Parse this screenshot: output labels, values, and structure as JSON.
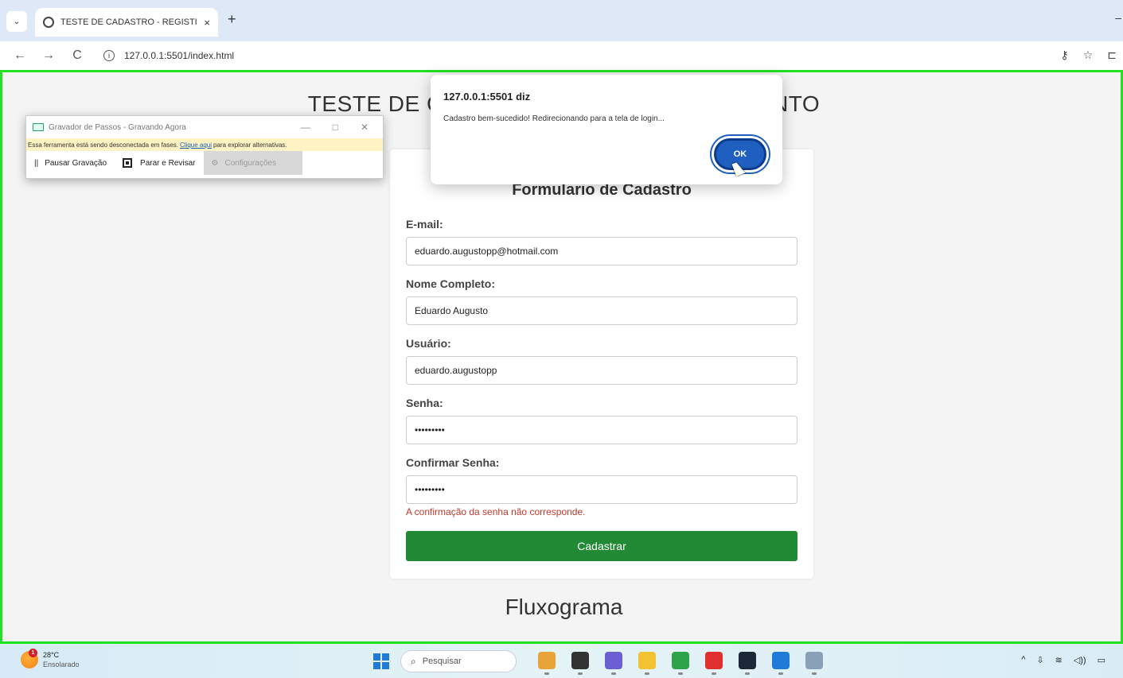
{
  "browser": {
    "tab_title": "TESTE DE CADASTRO - REGISTI",
    "tab_close": "×",
    "tab_list": "⌄",
    "new_tab": "+",
    "window_minimize": "–",
    "nav_back": "←",
    "nav_forward": "→",
    "nav_reload": "C",
    "url_icon": "i",
    "url": "127.0.0.1:5501/index.html",
    "toolbar_icons": [
      "key-icon",
      "star-icon",
      "extensions-icon"
    ],
    "toolbar_glyphs": [
      "⚷",
      "☆",
      "⊏"
    ]
  },
  "page": {
    "title": "TESTE DE CADASTRO - REGISTRO DE PONTO",
    "form": {
      "title": "Formulario de Cadastro",
      "email_label": "E-mail:",
      "email_value": "eduardo.augustopp@hotmail.com",
      "name_label": "Nome Completo:",
      "name_value": "Eduardo Augusto",
      "user_label": "Usuário:",
      "user_value": "eduardo.augustopp",
      "password_label": "Senha:",
      "password_value": "•••••••••",
      "confirm_label": "Confirmar Senha:",
      "confirm_value": "•••••••••",
      "error": "A confirmação da senha não corresponde.",
      "submit": "Cadastrar"
    },
    "section_title": "Fluxograma"
  },
  "alert": {
    "origin": "127.0.0.1:5501 diz",
    "message": "Cadastro bem-sucedido! Redirecionando para a tela de login...",
    "ok": "OK"
  },
  "recorder": {
    "title": "Gravador de Passos - Gravando Agora",
    "win_min": "—",
    "win_max": "□",
    "win_close": "✕",
    "banner_prefix": "Essa ferramenta está sendo desconectada em fases.",
    "banner_link": "Clique aqui",
    "banner_suffix": "para explorar alternativas.",
    "pause_icon": "||",
    "pause": "Pausar Gravação",
    "stop": "Parar e Revisar",
    "settings_icon": "⚙",
    "settings": "Configurações"
  },
  "taskbar": {
    "weather_badge": "1",
    "temperature": "28°C",
    "condition": "Ensolarado",
    "search_icon": "⌕",
    "search_placeholder": "Pesquisar",
    "apps": [
      {
        "name": "widgets-app-icon",
        "color": "#e8a33a"
      },
      {
        "name": "store-app-icon",
        "color": "#333333"
      },
      {
        "name": "copilot-app-icon",
        "color": "#6b5fd3"
      },
      {
        "name": "file-explorer-app-icon",
        "color": "#f2c230"
      },
      {
        "name": "chrome-app-icon",
        "color": "#2fa34a"
      },
      {
        "name": "opera-app-icon",
        "color": "#e02f2f"
      },
      {
        "name": "steam-app-icon",
        "color": "#1b2838"
      },
      {
        "name": "vscode-app-icon",
        "color": "#1f7ad8"
      },
      {
        "name": "misc-app-icon",
        "color": "#8aa0b8"
      }
    ],
    "tray_glyphs": [
      "^",
      "⇩",
      "≋",
      "◁))",
      "▭"
    ]
  }
}
